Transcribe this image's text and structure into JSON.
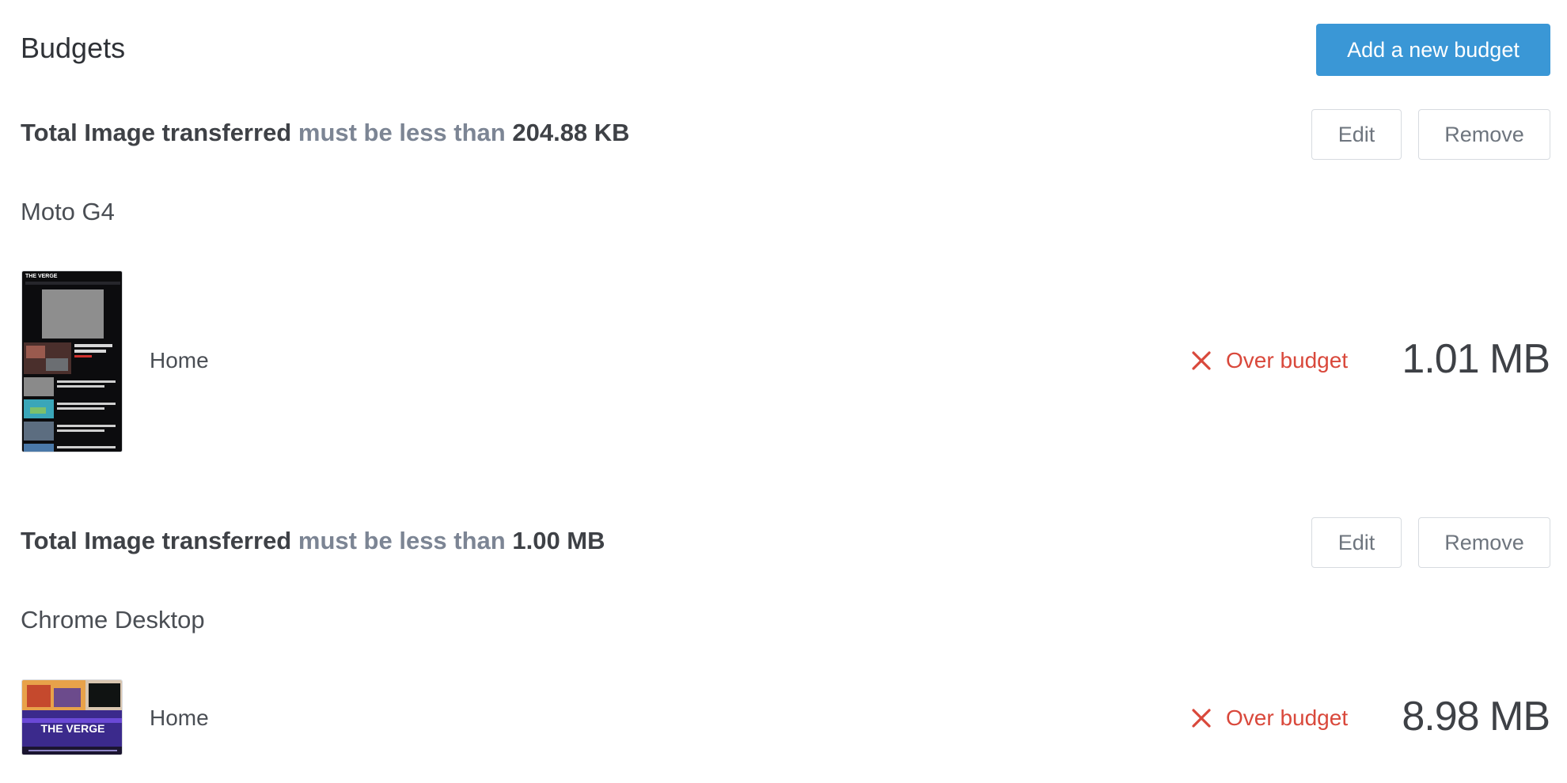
{
  "header": {
    "title": "Budgets",
    "add_button_label": "Add a new budget"
  },
  "budgets": [
    {
      "metric_label": "Total Image transferred",
      "condition": "must be less than",
      "threshold": "204.88 KB",
      "edit_label": "Edit",
      "remove_label": "Remove",
      "device": "Moto G4",
      "page": "Home",
      "status": "Over budget",
      "value": "1.01 MB",
      "thumbnail_logo": "THE VERGE"
    },
    {
      "metric_label": "Total Image transferred",
      "condition": "must be less than",
      "threshold": "1.00 MB",
      "edit_label": "Edit",
      "remove_label": "Remove",
      "device": "Chrome Desktop",
      "page": "Home",
      "status": "Over budget",
      "value": "8.98 MB",
      "thumbnail_logo": "THE VERGE"
    }
  ],
  "colors": {
    "accent": "#3a97d6",
    "danger": "#d9483b",
    "muted": "#7c8594"
  },
  "icons": {
    "status": "close-x-icon"
  }
}
